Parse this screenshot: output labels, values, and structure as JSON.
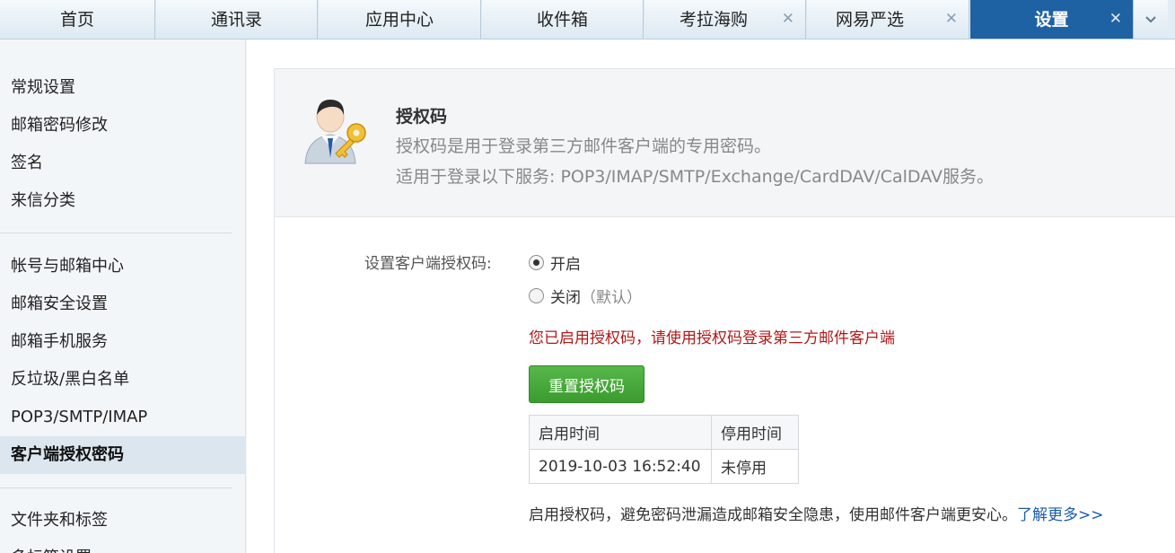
{
  "tabs": [
    {
      "label": "首页",
      "closable": false,
      "active": false
    },
    {
      "label": "通讯录",
      "closable": false,
      "active": false
    },
    {
      "label": "应用中心",
      "closable": false,
      "active": false
    },
    {
      "label": "收件箱",
      "closable": false,
      "active": false
    },
    {
      "label": "考拉海购",
      "closable": true,
      "active": false
    },
    {
      "label": "网易严选",
      "closable": true,
      "active": false
    },
    {
      "label": "设置",
      "closable": true,
      "active": true
    }
  ],
  "tab_close_glyph": "✕",
  "tab_more_glyph": "⌄",
  "sidebar": {
    "group1": [
      "常规设置",
      "邮箱密码修改",
      "签名",
      "来信分类"
    ],
    "group2": [
      "帐号与邮箱中心",
      "邮箱安全设置",
      "邮箱手机服务",
      "反垃圾/黑白名单",
      "POP3/SMTP/IMAP",
      "客户端授权密码"
    ],
    "group3": [
      "文件夹和标签",
      "多标签设置"
    ],
    "active_item": "客户端授权密码"
  },
  "header": {
    "title": "授权码",
    "desc1": "授权码是用于登录第三方邮件客户端的专用密码。",
    "desc2": "适用于登录以下服务: POP3/IMAP/SMTP/Exchange/CardDAV/CalDAV服务。",
    "icon": "user-key-icon"
  },
  "form": {
    "label": "设置客户端授权码:",
    "option_on": "开启",
    "option_off": "关闭",
    "option_off_hint": "（默认）",
    "selected": "on",
    "notice": "您已启用授权码，请使用授权码登录第三方邮件客户端",
    "reset_button": "重置授权码"
  },
  "table": {
    "headers": [
      "启用时间",
      "停用时间"
    ],
    "rows": [
      [
        "2019-10-03 16:52:40",
        "未停用"
      ]
    ]
  },
  "footer": {
    "text": "启用授权码，避免密码泄漏造成邮箱安全隐患，使用邮件客户端更安心。",
    "link": "了解更多>>"
  },
  "colors": {
    "active_tab": "#1f62a3",
    "notice": "#b11818",
    "button": "#48ab3c",
    "link": "#1b5dad"
  }
}
